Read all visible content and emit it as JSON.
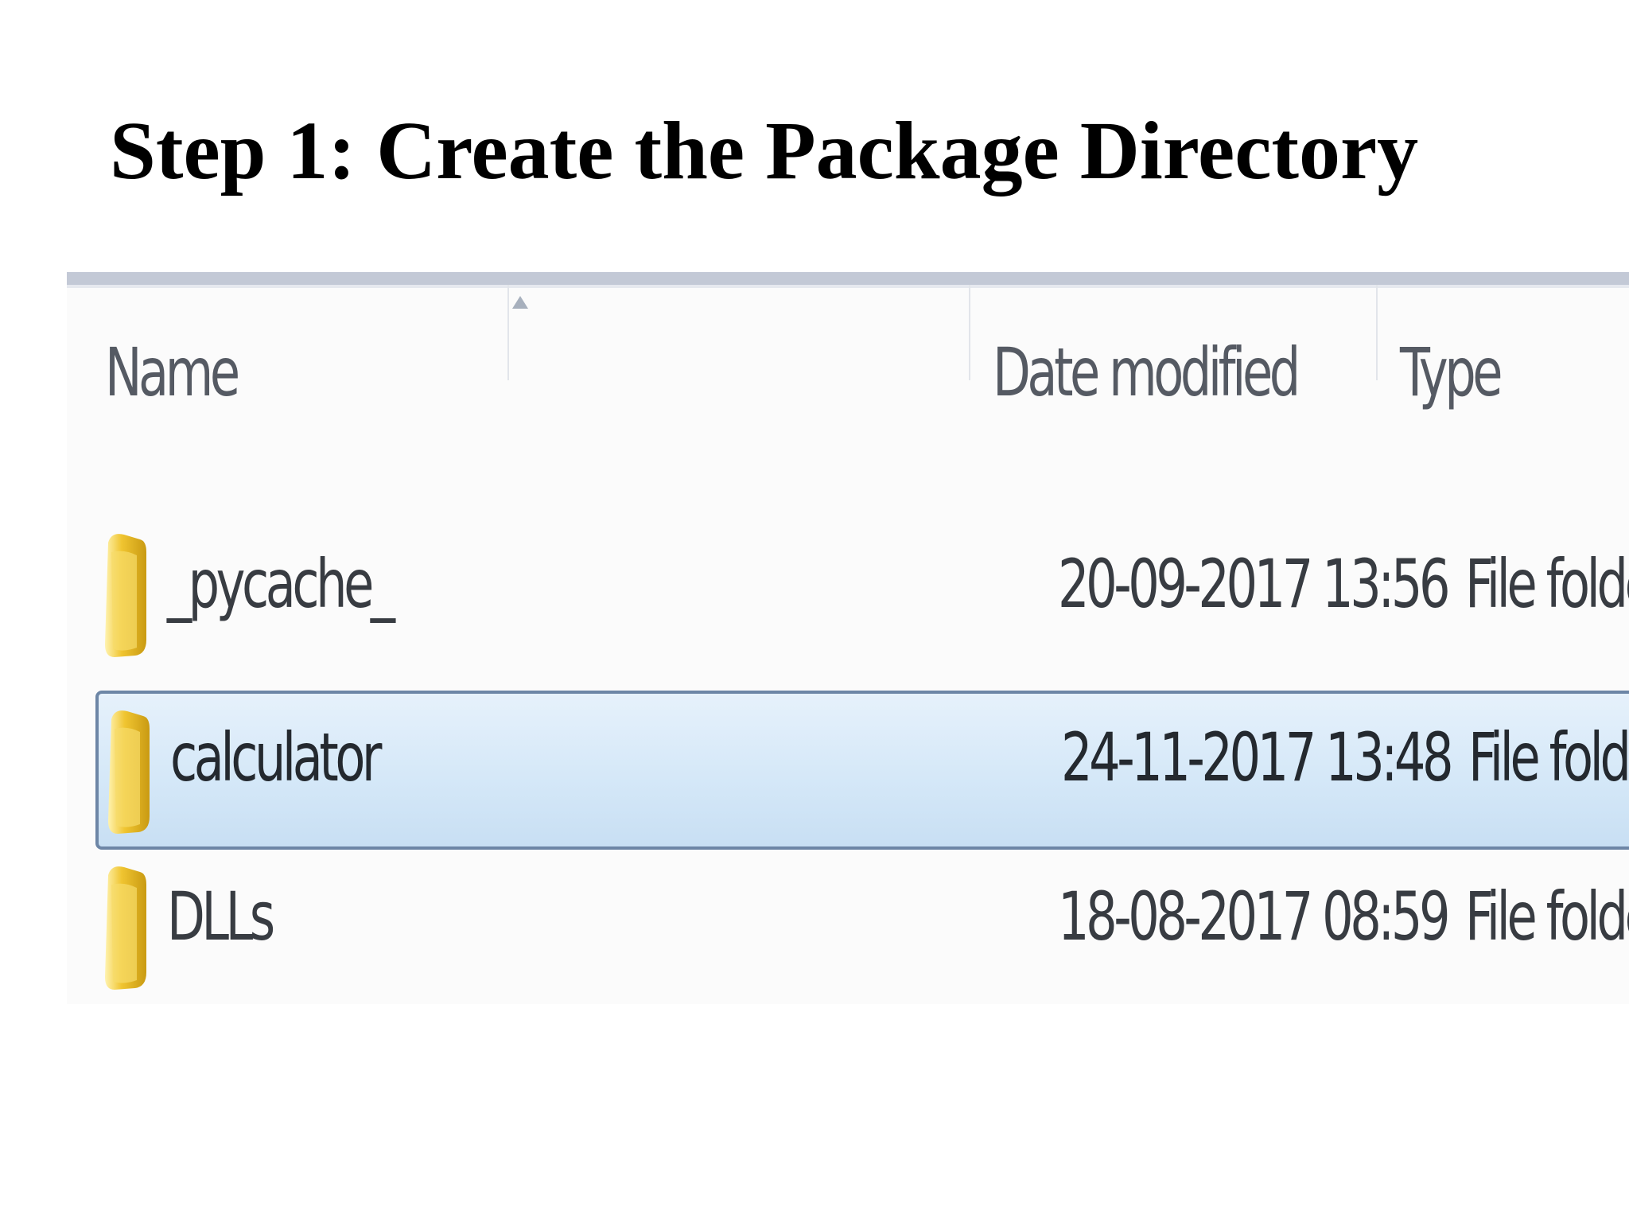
{
  "slide": {
    "title": "Step 1: Create the Package Directory"
  },
  "explorer": {
    "columns": {
      "name": "Name",
      "date_modified": "Date modified",
      "type": "Type"
    },
    "rows": [
      {
        "name": "_pycache_",
        "date_modified": "20-09-2017 13:56",
        "type": "File folder",
        "icon": "folder-icon",
        "selected": false
      },
      {
        "name": "calculator",
        "date_modified": "24-11-2017 13:48",
        "type": "File folder",
        "icon": "folder-icon",
        "selected": true
      },
      {
        "name": "DLLs",
        "date_modified": "18-08-2017 08:59",
        "type": "File folder",
        "icon": "folder-icon",
        "selected": false
      }
    ],
    "colors": {
      "selection_background": "#d5e8f8",
      "selection_border": "#6d86a6",
      "folder_yellow": "#f0c531"
    }
  }
}
